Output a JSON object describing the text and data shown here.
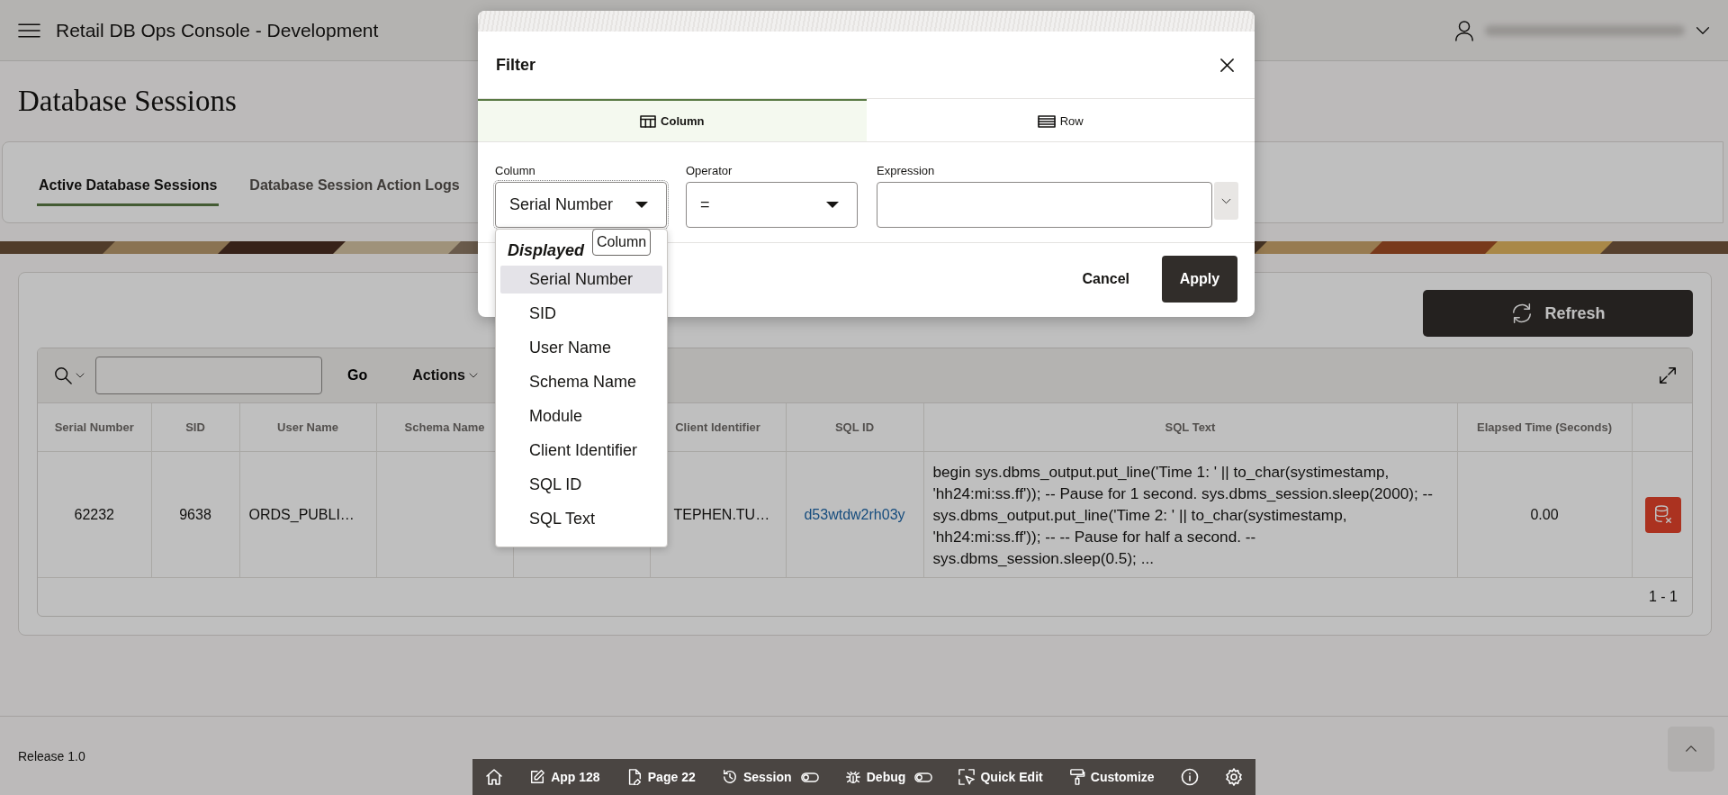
{
  "app_header": {
    "title": "Retail DB Ops Console - Development"
  },
  "page_title": "Database Sessions",
  "tabs": [
    {
      "label": "Active Database Sessions",
      "selected": true
    },
    {
      "label": "Database Session Action Logs",
      "selected": false
    }
  ],
  "region": {
    "refresh_button": "Refresh",
    "grid": {
      "toolbar": {
        "go_button": "Go",
        "actions_menu": "Actions"
      },
      "columns": [
        {
          "label": "Serial Number"
        },
        {
          "label": "SID"
        },
        {
          "label": "User Name"
        },
        {
          "label": "Schema Name"
        },
        {},
        {
          "label": "Client Identifier"
        },
        {
          "label": "SQL ID"
        },
        {
          "label": "SQL Text"
        },
        {
          "label": "Elapsed Time (Seconds)"
        },
        {}
      ],
      "rows": [
        {
          "cells": [
            {
              "kind": "text",
              "text": "62232"
            },
            {
              "kind": "text",
              "text": "9638"
            },
            {
              "kind": "text",
              "text": "ORDS_PUBLI…"
            },
            {},
            {},
            {
              "kind": "text",
              "text": "TEPHEN.TU…"
            },
            {
              "kind": "link",
              "text": "d53wtdw2rh03y"
            },
            {
              "kind": "text",
              "text": "begin sys.dbms_output.put_line('Time 1: ' || to_char(systimestamp, 'hh24:mi:ss.ff')); -- Pause for 1 second. sys.dbms_session.sleep(2000); -- sys.dbms_output.put_line('Time 2: ' || to_char(systimestamp, 'hh24:mi:ss.ff')); -- -- Pause for half a second. -- sys.dbms_session.sleep(0.5); ..."
            },
            {
              "kind": "text",
              "text": "0.00"
            },
            {
              "kind": "action"
            }
          ]
        }
      ],
      "pagination": "1 - 1"
    }
  },
  "footer": {
    "release": "Release 1.0"
  },
  "dev_toolbar": [
    {
      "kind": "icon"
    },
    {
      "kind": "button",
      "label": "App 128"
    },
    {
      "kind": "button",
      "label": "Page 22"
    },
    {
      "kind": "toggle",
      "label": "Session",
      "on": false
    },
    {
      "kind": "toggle",
      "label": "Debug",
      "on": false
    },
    {
      "kind": "button",
      "label": "Quick Edit"
    },
    {
      "kind": "button",
      "label": "Customize"
    },
    {
      "kind": "icon"
    },
    {
      "kind": "icon"
    }
  ],
  "filter_dialog": {
    "title": "Filter",
    "tabs": [
      {
        "label": "Column",
        "selected": true
      },
      {
        "label": "Row",
        "selected": false
      }
    ],
    "fields": [
      {
        "kind": "select",
        "label": "Column",
        "value": "Serial Number"
      },
      {
        "kind": "select",
        "label": "Operator",
        "value": "="
      },
      {
        "kind": "combo",
        "label": "Expression"
      }
    ],
    "column_dropdown": {
      "group": "Displayed",
      "items": [
        {
          "label": "Serial Number",
          "selected": true
        },
        {
          "label": "SID",
          "selected": false
        },
        {
          "label": "User Name",
          "selected": false
        },
        {
          "label": "Schema Name",
          "selected": false
        },
        {
          "label": "Module",
          "selected": false
        },
        {
          "label": "Client Identifier",
          "selected": false
        },
        {
          "label": "SQL ID",
          "selected": false
        },
        {
          "label": "SQL Text",
          "selected": false
        }
      ]
    },
    "tooltip": "Column",
    "buttons": [
      {
        "kind": "secondary",
        "label": "Cancel"
      },
      {
        "kind": "primary",
        "label": "Apply"
      }
    ]
  }
}
